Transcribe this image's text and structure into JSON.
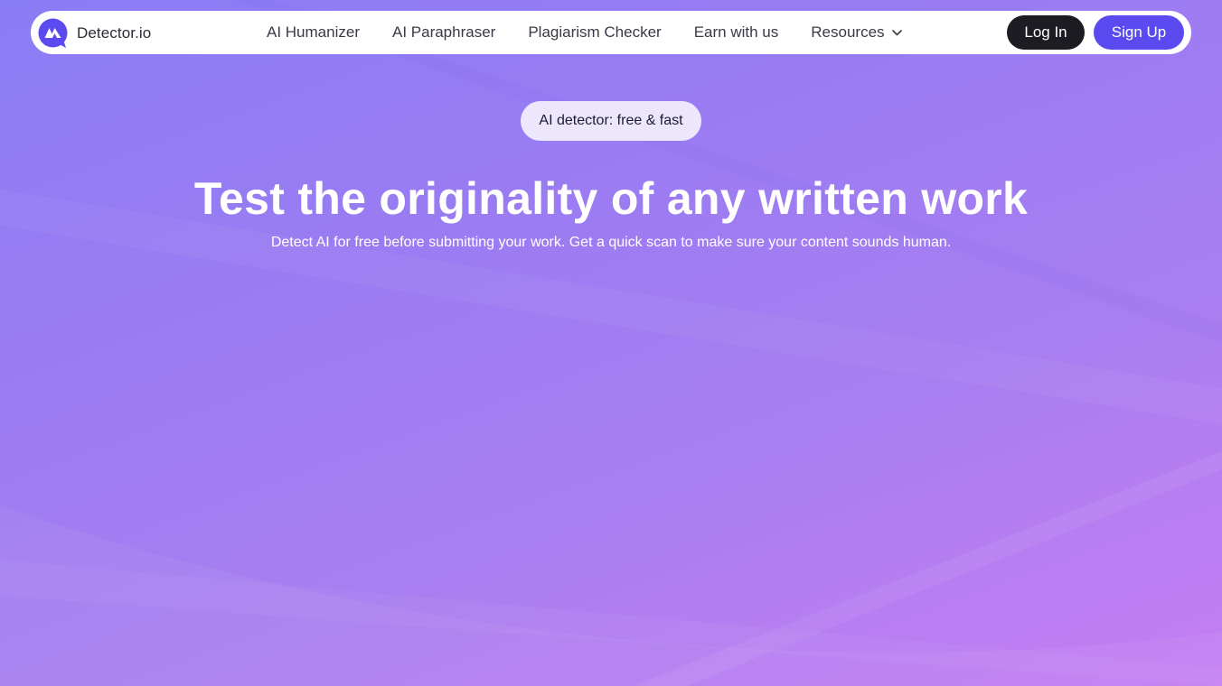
{
  "nav": {
    "brand": "Detector.io",
    "links": [
      "AI Humanizer",
      "AI Paraphraser",
      "Plagiarism Checker",
      "Earn with us",
      "Resources"
    ],
    "login_label": "Log In",
    "signup_label": "Sign Up"
  },
  "hero": {
    "badge": "AI detector: free & fast",
    "title": "Test the originality of any written work",
    "subtitle": "Detect AI for free before submitting your work. Get a quick scan to make sure your content sounds human."
  },
  "colors": {
    "brand_accent": "#5a4af0",
    "login_button": "#1c1c22",
    "background_start": "#8a7cf6",
    "background_end": "#c47ef3"
  },
  "icons": {
    "logo": "detector-logo-icon",
    "resources_dropdown": "chevron-down-icon"
  }
}
